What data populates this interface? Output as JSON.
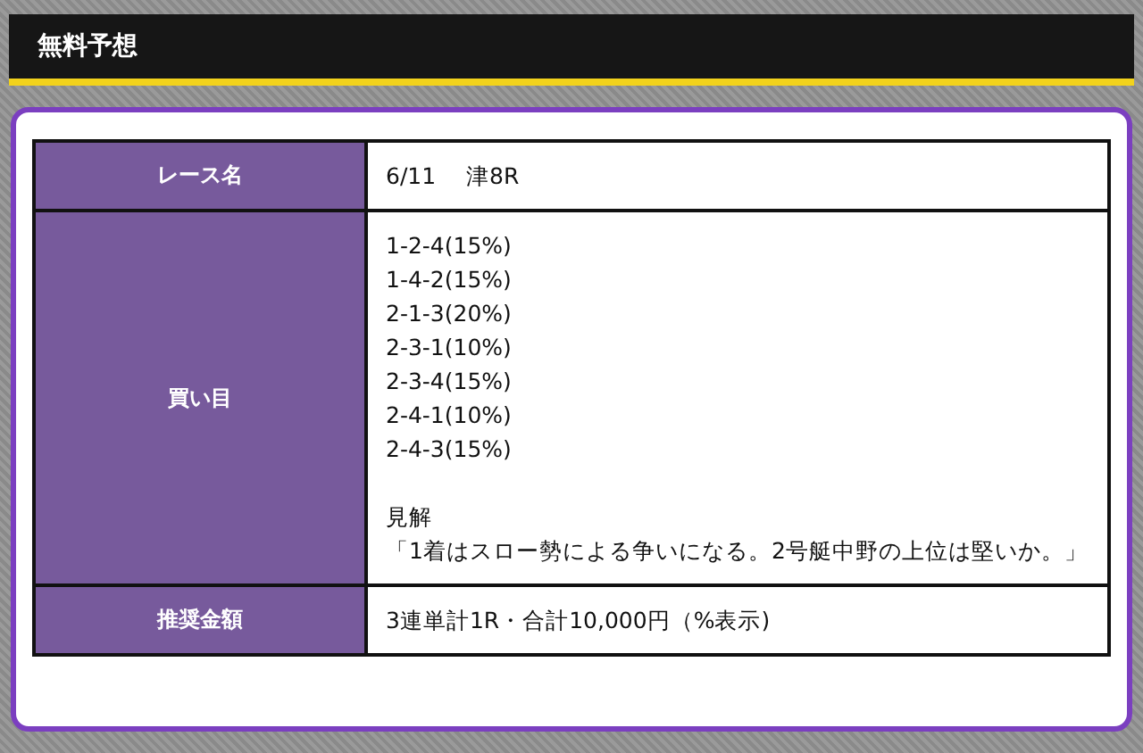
{
  "header": {
    "title": "無料予想"
  },
  "table": {
    "rows": [
      {
        "label": "レース名",
        "paragraphs": [
          [
            "6/11　 津8R"
          ]
        ]
      },
      {
        "label": "買い目",
        "paragraphs": [
          [
            "1-2-4(15%)",
            "1-4-2(15%)",
            "2-1-3(20%)",
            "2-3-1(10%)",
            "2-3-4(15%)",
            "2-4-1(10%)",
            "2-4-3(15%)"
          ],
          [
            "見解",
            "「1着はスロー勢による争いになる。2号艇中野の上位は堅いか。」"
          ]
        ]
      },
      {
        "label": "推奨金額",
        "paragraphs": [
          [
            "3連単計1R・合計10,000円（%表示)"
          ]
        ]
      }
    ]
  }
}
